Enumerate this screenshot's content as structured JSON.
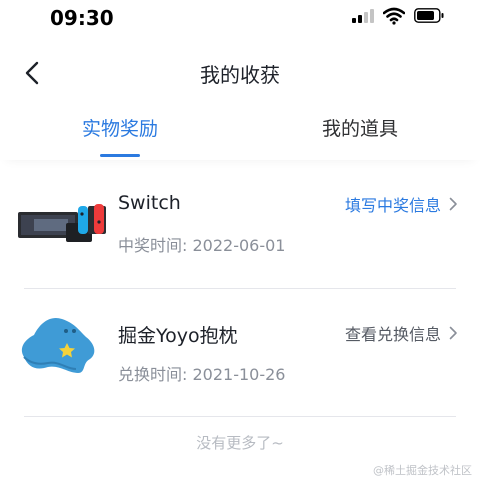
{
  "status_bar": {
    "time": "09:30"
  },
  "nav": {
    "title": "我的收获"
  },
  "tabs": [
    {
      "label": "实物奖励",
      "active": true
    },
    {
      "label": "我的道具",
      "active": false
    }
  ],
  "rewards": [
    {
      "name": "Switch",
      "date_label": "中奖时间: 2022-06-01",
      "action_label": "填写中奖信息",
      "thumb_icon": "nintendo-switch-icon"
    },
    {
      "name": "掘金Yoyo抱枕",
      "date_label": "兑换时间: 2021-10-26",
      "action_label": "查看兑换信息",
      "thumb_icon": "yoyo-pillow-icon"
    }
  ],
  "footer": {
    "no_more": "没有更多了~",
    "watermark": "@稀土掘金技术社区"
  },
  "colors": {
    "accent": "#2b7ae0",
    "text_primary": "#1d2129",
    "text_secondary": "#8a8f99",
    "divider": "#e5e6eb"
  }
}
